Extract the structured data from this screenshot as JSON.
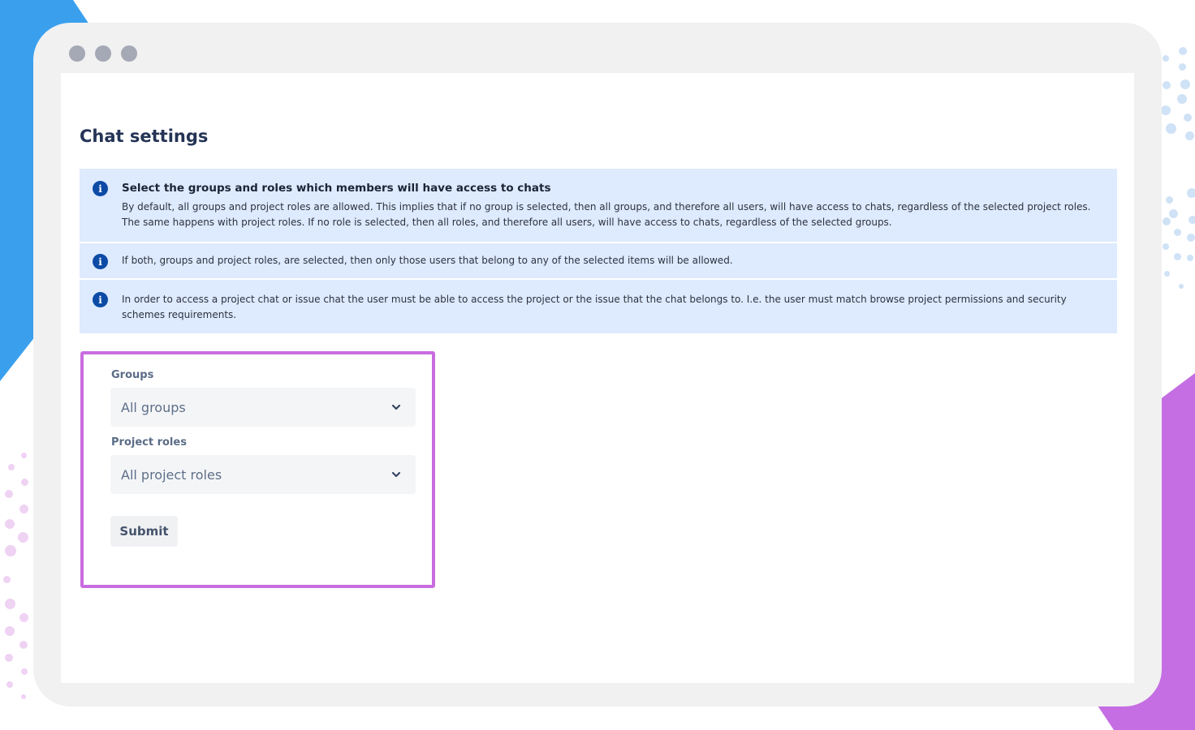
{
  "colors": {
    "accent_blue": "#3aa0ee",
    "accent_purple": "#c56ee3",
    "info_background": "#deeafd",
    "info_icon": "#0c4aa6",
    "highlight_border": "#c96cdf",
    "title_text": "#243455"
  },
  "window": {
    "traffic_lights": [
      "window-dot",
      "window-dot",
      "window-dot"
    ]
  },
  "page": {
    "title": "Chat settings"
  },
  "info": {
    "icon": "info-icon",
    "items": [
      {
        "heading": "Select the groups and roles which members will have access to chats",
        "text": "By default, all groups and project roles are allowed. This implies that if no group is selected, then all groups, and therefore all users, will have access to chats, regardless of the selected project roles. The same happens with project roles. If no role is selected, then all roles, and therefore all users, will have access to chats, regardless of the selected groups."
      },
      {
        "text": "If both, groups and project roles, are selected, then only those users that belong to any of the selected items will be allowed."
      },
      {
        "text": "In order to access a project chat or issue chat the user must be able to access the project or the issue that the chat belongs to. I.e. the user must match browse project permissions and security schemes requirements."
      }
    ]
  },
  "form": {
    "groups": {
      "label": "Groups",
      "selected": "All groups",
      "icon": "chevron-down-icon"
    },
    "project_roles": {
      "label": "Project roles",
      "selected": "All project roles",
      "icon": "chevron-down-icon"
    },
    "submit_label": "Submit"
  }
}
